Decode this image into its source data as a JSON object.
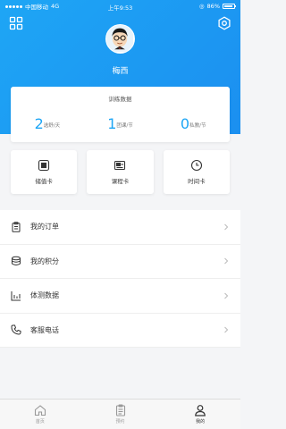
{
  "statusbar": {
    "carrier": "中国移动",
    "network": "4G",
    "time": "上午9:53",
    "battery": "86%",
    "battery_level": 0.86
  },
  "profile": {
    "nickname": "梅西"
  },
  "stats": {
    "title": "训练数据",
    "items": [
      {
        "value": "2",
        "unit": "选舒/天"
      },
      {
        "value": "1",
        "unit": "团课/节"
      },
      {
        "value": "0",
        "unit": "私教/节"
      }
    ]
  },
  "cards": [
    {
      "label": "储值卡",
      "icon": "wallet-icon"
    },
    {
      "label": "课程卡",
      "icon": "course-card-icon"
    },
    {
      "label": "时间卡",
      "icon": "clock-icon"
    }
  ],
  "menu": [
    {
      "label": "我的订单",
      "icon": "clipboard-icon"
    },
    {
      "label": "我的积分",
      "icon": "coins-icon"
    },
    {
      "label": "体测数据",
      "icon": "bar-chart-icon"
    },
    {
      "label": "客服电话",
      "icon": "phone-icon"
    }
  ],
  "tabs": [
    {
      "label": "首页",
      "icon": "home-icon",
      "active": false
    },
    {
      "label": "预约",
      "icon": "calendar-icon",
      "active": false
    },
    {
      "label": "我的",
      "icon": "user-icon",
      "active": true
    }
  ],
  "colors": {
    "primary": "#1ea6f5",
    "background": "#f4f5f7"
  }
}
